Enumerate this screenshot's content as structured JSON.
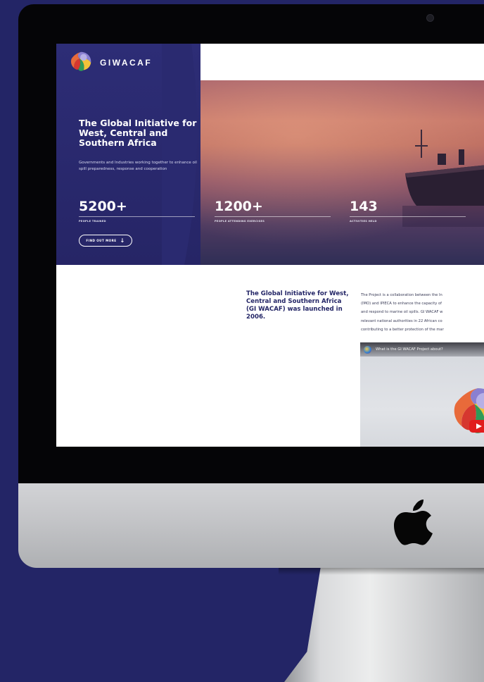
{
  "site": {
    "brand_name": "GIWACAF"
  },
  "hero": {
    "title": "The Global Initiative for West, Central and Southern Africa",
    "subtitle": "Governments and Industries working together to enhance oil spill preparedness, response and cooperation",
    "stats": [
      {
        "value": "5200+",
        "label": "PEOPLE TRAINED"
      },
      {
        "value": "1200+",
        "label": "PEOPLE ATTENDING EXERCISES"
      },
      {
        "value": "143",
        "label": "ACTIVITIES HELD"
      }
    ],
    "cta_label": "FIND OUT MORE",
    "cta_icon": "arrow-down-icon"
  },
  "about": {
    "heading": "The Global Initiative for West, Central and Southern Africa (GI WACAF) was launched in 2006.",
    "lines": [
      "The Project is a collaboration between the In",
      "(IMO) and IPIECA to enhance the capacity of",
      "and respond to marine oil spills. GI WACAF w",
      "relevant national authorities in 22 African co",
      "contributing to a better protection of the mar"
    ]
  },
  "video": {
    "title": "What is the GI WACAF Project about?",
    "play_icon": "youtube-play-icon"
  },
  "colors": {
    "navy": "#232566",
    "panel": "#2d2d76",
    "youtube_red": "#e11c1c"
  }
}
